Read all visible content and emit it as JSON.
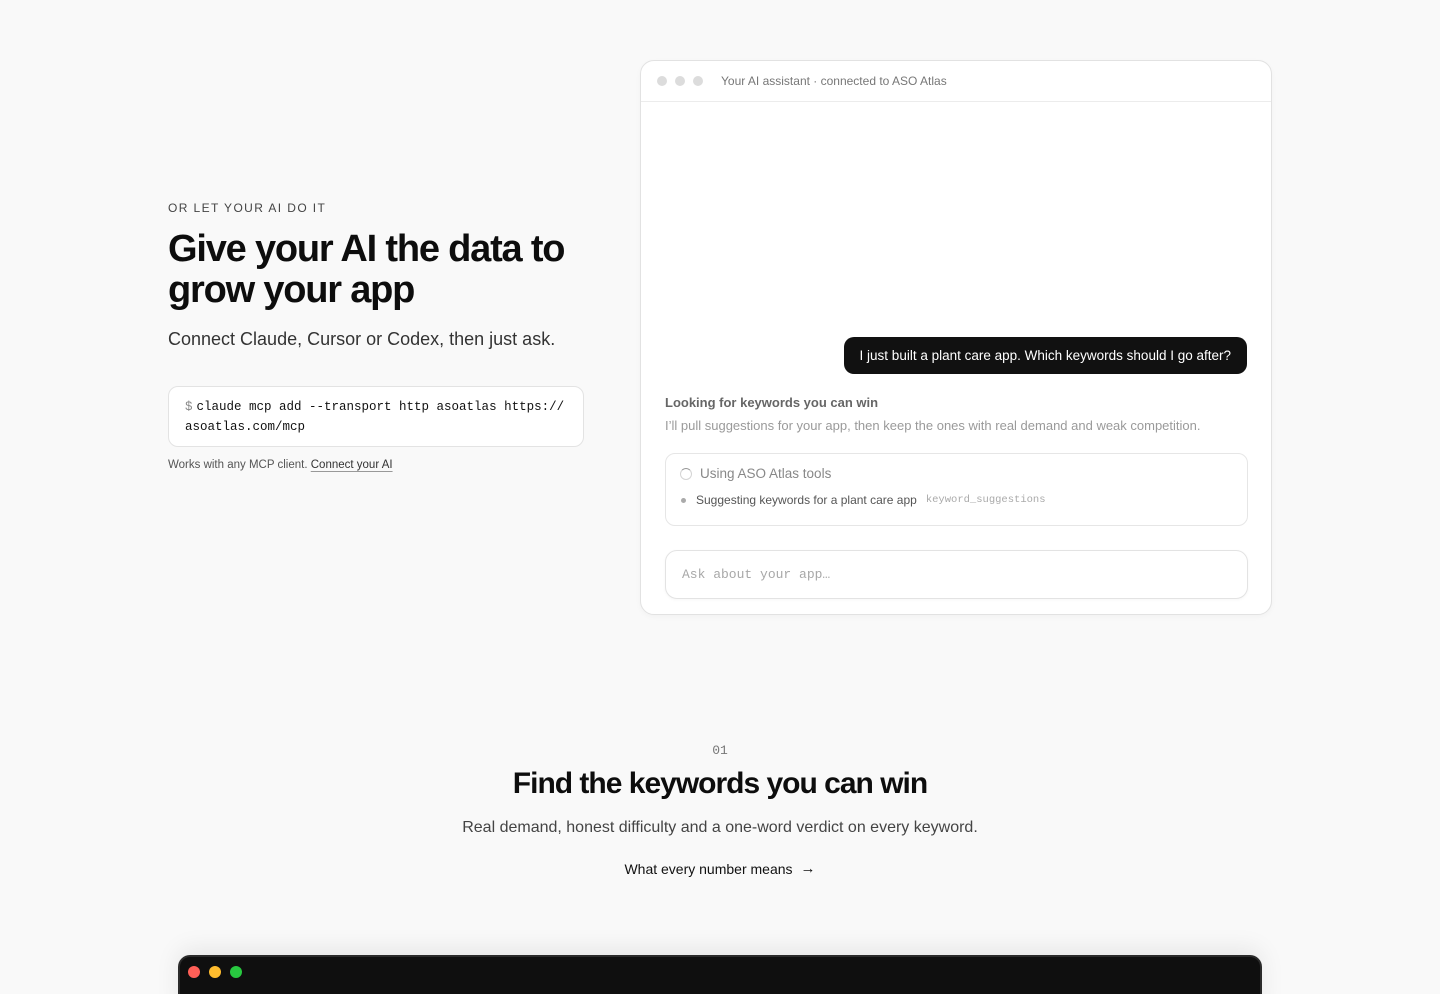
{
  "hero": {
    "eyebrow": "OR LET YOUR AI DO IT",
    "title": "Give your AI the data to grow your app",
    "subtitle": "Connect Claude, Cursor or Codex, then just ask.",
    "command_prompt": "$",
    "command": "claude mcp add --transport http asoatlas https://asoatlas.com/mcp",
    "works_text": "Works with any MCP client.",
    "works_link": "Connect your AI"
  },
  "chat": {
    "titlebar": "Your AI assistant · connected to ASO Atlas",
    "user_message": "I just built a plant care app. Which keywords should I go after?",
    "reply_heading": "Looking for keywords you can win",
    "reply_text": "I’ll pull suggestions for your app, then keep the ones with real demand and weak competition.",
    "tools_heading": "Using ASO Atlas tools",
    "tool_step": "Suggesting keywords for a plant care app",
    "tool_name": "keyword_suggestions",
    "input_placeholder": "Ask about your app…"
  },
  "section": {
    "number": "01",
    "title": "Find the keywords you can win",
    "subtitle": "Real demand, honest difficulty and a one-word verdict on every keyword.",
    "link": "What every number means",
    "link_icon": "→"
  },
  "colors": {
    "traffic_red": "#ff5f57",
    "traffic_yellow": "#febc2e",
    "traffic_green": "#28c840"
  }
}
